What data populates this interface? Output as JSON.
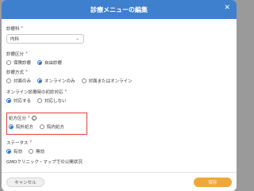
{
  "modal": {
    "title": "診療メニューの編集",
    "close_symbol": "✕"
  },
  "fields": {
    "department": {
      "label": "診療科",
      "required_mark": "*",
      "value": "内科",
      "icon": "chevron-down-icon"
    },
    "treatment_category": {
      "label": "診療区分",
      "required_mark": "*",
      "options": [
        {
          "label": "保険診療",
          "selected": false
        },
        {
          "label": "自由診療",
          "selected": true
        }
      ]
    },
    "treatment_method": {
      "label": "診療方式",
      "required_mark": "*",
      "options": [
        {
          "label": "対面のみ",
          "selected": false
        },
        {
          "label": "オンラインのみ",
          "selected": true
        },
        {
          "label": "対面またはオンライン",
          "selected": false
        }
      ]
    },
    "first_visit": {
      "label": "オンライン診療時の初診対応",
      "required_mark": "*",
      "options": [
        {
          "label": "対応する",
          "selected": true
        },
        {
          "label": "対応しない",
          "selected": false
        }
      ]
    },
    "prescription": {
      "label": "処方区分",
      "required_mark": "*",
      "info": "i",
      "options": [
        {
          "label": "院外処方",
          "selected": true
        },
        {
          "label": "院内処方",
          "selected": false
        }
      ],
      "highlight_color": "#e0413a"
    },
    "status": {
      "label": "ステータス",
      "required_mark": "*",
      "options": [
        {
          "label": "有効",
          "selected": true
        },
        {
          "label": "無効",
          "selected": false
        }
      ]
    },
    "gmo_public": {
      "label": "GMOクリニック・マップでの公開状況"
    }
  },
  "footer": {
    "cancel_label": "キャンセル",
    "save_label": "保存"
  },
  "colors": {
    "header": "#3f80ce",
    "accent": "#2f72c8",
    "required": "#e03030",
    "save": "#eea83a"
  }
}
